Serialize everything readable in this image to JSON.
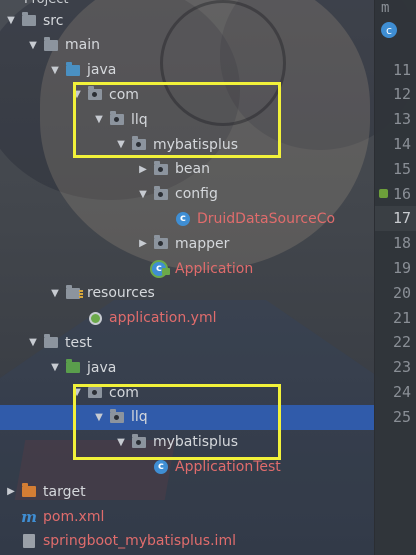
{
  "panel": {
    "title": "Project"
  },
  "tree": [
    {
      "label": "src",
      "depth": 1,
      "arrow": "down",
      "icon": "folder"
    },
    {
      "label": "main",
      "depth": 2,
      "arrow": "down",
      "icon": "folder"
    },
    {
      "label": "java",
      "depth": 3,
      "arrow": "down",
      "icon": "folder-blue"
    },
    {
      "label": "com",
      "depth": 4,
      "arrow": "down",
      "icon": "package"
    },
    {
      "label": "llq",
      "depth": 5,
      "arrow": "down",
      "icon": "package"
    },
    {
      "label": "mybatisplus",
      "depth": 6,
      "arrow": "down",
      "icon": "package"
    },
    {
      "label": "bean",
      "depth": 7,
      "arrow": "right",
      "icon": "package"
    },
    {
      "label": "config",
      "depth": 7,
      "arrow": "down",
      "icon": "package"
    },
    {
      "label": "DruidDataSourceCo",
      "depth": 8,
      "arrow": "",
      "icon": "class",
      "color": "red"
    },
    {
      "label": "mapper",
      "depth": 7,
      "arrow": "right",
      "icon": "package"
    },
    {
      "label": "Application",
      "depth": 7,
      "arrow": "",
      "icon": "spring-class",
      "color": "red"
    },
    {
      "label": "resources",
      "depth": 3,
      "arrow": "down",
      "icon": "folder-resources"
    },
    {
      "label": "application.yml",
      "depth": 4,
      "arrow": "",
      "icon": "spring-yml",
      "color": "red"
    },
    {
      "label": "test",
      "depth": 2,
      "arrow": "down",
      "icon": "folder"
    },
    {
      "label": "java",
      "depth": 3,
      "arrow": "down",
      "icon": "folder-green"
    },
    {
      "label": "com",
      "depth": 4,
      "arrow": "down",
      "icon": "package"
    },
    {
      "label": "llq",
      "depth": 5,
      "arrow": "down",
      "icon": "package",
      "selected": true
    },
    {
      "label": "mybatisplus",
      "depth": 6,
      "arrow": "down",
      "icon": "package"
    },
    {
      "label": "ApplicationTest",
      "depth": 7,
      "arrow": "",
      "icon": "class",
      "color": "red"
    },
    {
      "label": "target",
      "depth": 1,
      "arrow": "right",
      "icon": "folder-orange"
    },
    {
      "label": "pom.xml",
      "depth": 1,
      "arrow": "",
      "icon": "maven",
      "color": "red"
    },
    {
      "label": "springboot_mybatisplus.iml",
      "depth": 1,
      "arrow": "",
      "icon": "iml",
      "color": "red"
    }
  ],
  "gutter": {
    "top_letter": "m",
    "top_icon": "c",
    "lines": [
      "11",
      "12",
      "13",
      "14",
      "15",
      "16",
      "17",
      "18",
      "19",
      "20",
      "21",
      "22",
      "23",
      "24",
      "25"
    ],
    "current_line": "17",
    "marker_lines": [
      "16"
    ]
  },
  "annotations": [
    {
      "name": "main-package-highlight",
      "color": "#f2f23a"
    },
    {
      "name": "test-package-highlight",
      "color": "#f2f23a"
    }
  ]
}
